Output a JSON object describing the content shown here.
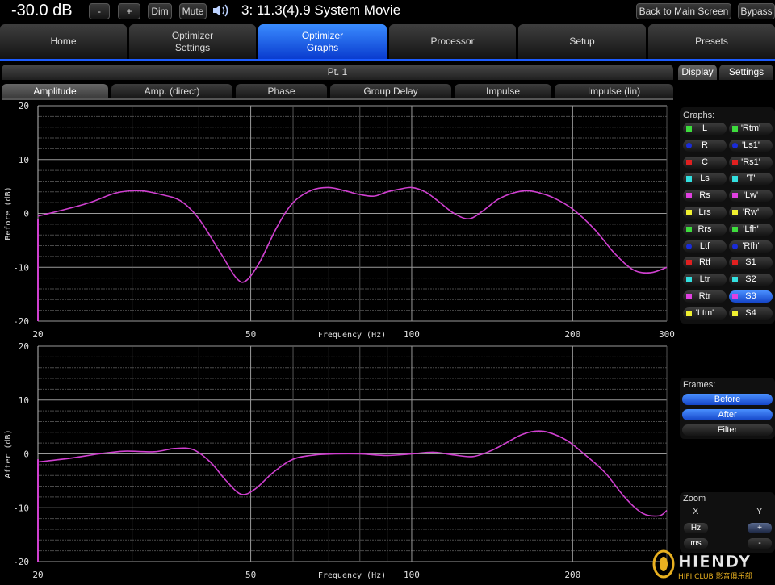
{
  "topbar": {
    "volume": "-30.0 dB",
    "minus": "-",
    "plus": "+",
    "dim": "Dim",
    "mute": "Mute",
    "title": "3: 11.3(4).9 System Movie",
    "back": "Back to Main Screen",
    "bypass": "Bypass"
  },
  "tabs": [
    {
      "l1": "Home",
      "l2": ""
    },
    {
      "l1": "Optimizer",
      "l2": "Settings"
    },
    {
      "l1": "Optimizer",
      "l2": "Graphs"
    },
    {
      "l1": "Processor",
      "l2": ""
    },
    {
      "l1": "Setup",
      "l2": ""
    },
    {
      "l1": "Presets",
      "l2": ""
    }
  ],
  "pt": "Pt. 1",
  "subtabs": [
    "Amplitude",
    "Amp. (direct)",
    "Phase",
    "Group Delay",
    "Impulse",
    "Impulse (lin)"
  ],
  "rightTabs": {
    "display": "Display",
    "settings": "Settings"
  },
  "graphsLabel": "Graphs:",
  "channelsLeft": [
    {
      "label": "L",
      "color": "#3ddc3d"
    },
    {
      "label": "R",
      "color": "#1a2cd8"
    },
    {
      "label": "C",
      "color": "#e02020"
    },
    {
      "label": "Ls",
      "color": "#33e0e0"
    },
    {
      "label": "Rs",
      "color": "#e040e0"
    },
    {
      "label": "Lrs",
      "color": "#f0f030"
    },
    {
      "label": "Rrs",
      "color": "#3ddc3d"
    },
    {
      "label": "Ltf",
      "color": "#1a2cd8"
    },
    {
      "label": "Rtf",
      "color": "#e02020"
    },
    {
      "label": "Ltr",
      "color": "#33e0e0"
    },
    {
      "label": "Rtr",
      "color": "#e040e0"
    },
    {
      "label": "'Ltm'",
      "color": "#f0f030"
    }
  ],
  "channelsRight": [
    {
      "label": "'Rtm'",
      "color": "#3ddc3d"
    },
    {
      "label": "'Ls1'",
      "color": "#1a2cd8"
    },
    {
      "label": "'Rs1'",
      "color": "#e02020"
    },
    {
      "label": "'T'",
      "color": "#33e0e0"
    },
    {
      "label": "'Lw'",
      "color": "#e040e0"
    },
    {
      "label": "'Rw'",
      "color": "#f0f030"
    },
    {
      "label": "'Lfh'",
      "color": "#3ddc3d"
    },
    {
      "label": "'Rfh'",
      "color": "#1a2cd8"
    },
    {
      "label": "S1",
      "color": "#e02020"
    },
    {
      "label": "S2",
      "color": "#33e0e0"
    },
    {
      "label": "S3",
      "color": "#e040e0"
    },
    {
      "label": "S4",
      "color": "#f0f030"
    }
  ],
  "framesLabel": "Frames:",
  "frames": [
    "Before",
    "After",
    "Filter"
  ],
  "zoom": {
    "label": "Zoom",
    "x": "X",
    "y": "Y",
    "hz": "Hz",
    "ms": "ms",
    "plus": "+",
    "minus": "-"
  },
  "logo": {
    "brand": "HIENDY",
    "sub": "HIFI CLUB 影音俱乐部"
  },
  "chart_data": [
    {
      "type": "line",
      "ylabel": "Before (dB)",
      "xlabel": "Frequency (Hz)",
      "xscale": "log",
      "xlim": [
        20,
        300
      ],
      "ylim": [
        -20,
        20
      ],
      "xticks": [
        "20",
        "50",
        "100",
        "200",
        "300"
      ],
      "yticks": [
        "20",
        "10",
        "0",
        "-10",
        "-20"
      ],
      "grid": true,
      "lineColor": "#d040d0",
      "series": [
        {
          "x": [
            20,
            22,
            25,
            28,
            31,
            34,
            37,
            40,
            44,
            47,
            49,
            52,
            56,
            60,
            65,
            70,
            75,
            80,
            85,
            90,
            95,
            100,
            106,
            112,
            120,
            128,
            136,
            145,
            155,
            165,
            175,
            185,
            200,
            220,
            240,
            260,
            280,
            300
          ],
          "y": [
            -0.5,
            0.5,
            2,
            3.8,
            4.2,
            3.5,
            2.3,
            -1,
            -7.5,
            -12,
            -12.5,
            -9,
            -2.5,
            2,
            4.3,
            4.8,
            4.2,
            3.5,
            3.2,
            4,
            4.5,
            4.8,
            4,
            2.3,
            0,
            -1,
            0.5,
            2.6,
            3.8,
            4.2,
            3.7,
            2.8,
            0.8,
            -3,
            -7.5,
            -10.5,
            -11,
            -10
          ]
        }
      ]
    },
    {
      "type": "line",
      "ylabel": "After (dB)",
      "xlabel": "Frequency (Hz)",
      "xscale": "log",
      "xlim": [
        20,
        300
      ],
      "ylim": [
        -20,
        20
      ],
      "xticks": [
        "20",
        "50",
        "100",
        "200"
      ],
      "yticks": [
        "20",
        "10",
        "0",
        "-10",
        "-20"
      ],
      "grid": true,
      "lineColor": "#d040d0",
      "series": [
        {
          "x": [
            20,
            23,
            26,
            29,
            33,
            36,
            39,
            42,
            45,
            48,
            51,
            55,
            60,
            66,
            72,
            80,
            90,
            100,
            110,
            120,
            130,
            140,
            150,
            160,
            170,
            180,
            195,
            210,
            230,
            250,
            270,
            290,
            300
          ],
          "y": [
            -1.5,
            -0.8,
            0,
            0.5,
            0.4,
            1,
            0.8,
            -1.5,
            -5,
            -7.5,
            -6.5,
            -3.5,
            -1,
            -0.2,
            0,
            0,
            -0.3,
            0,
            0.3,
            -0.2,
            -0.5,
            0.5,
            2,
            3.5,
            4.2,
            4,
            2.5,
            0,
            -3.5,
            -8,
            -11,
            -11.5,
            -10.5
          ]
        }
      ]
    }
  ]
}
